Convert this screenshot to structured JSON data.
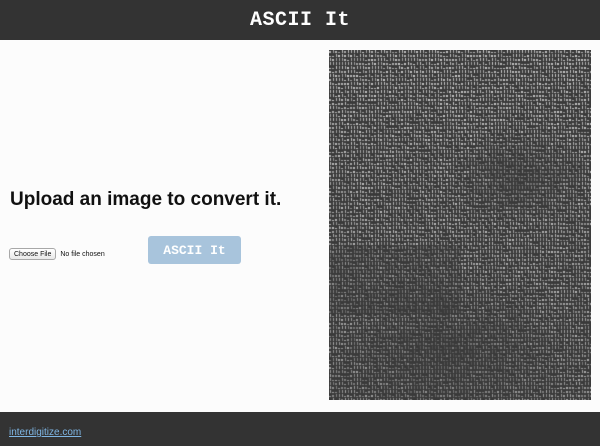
{
  "header": {
    "title": "ASCII It"
  },
  "upload": {
    "prompt": "Upload an image to convert it.",
    "choose_file_label": "Choose File",
    "file_status": "No file chosen",
    "convert_label": "ASCII It"
  },
  "footer": {
    "link_text": "interdigitize.com"
  },
  "colors": {
    "bar_background": "#333333",
    "convert_button": "#a8c4dc",
    "link": "#7fb6e4",
    "ascii_background": "#3a3a3a"
  }
}
